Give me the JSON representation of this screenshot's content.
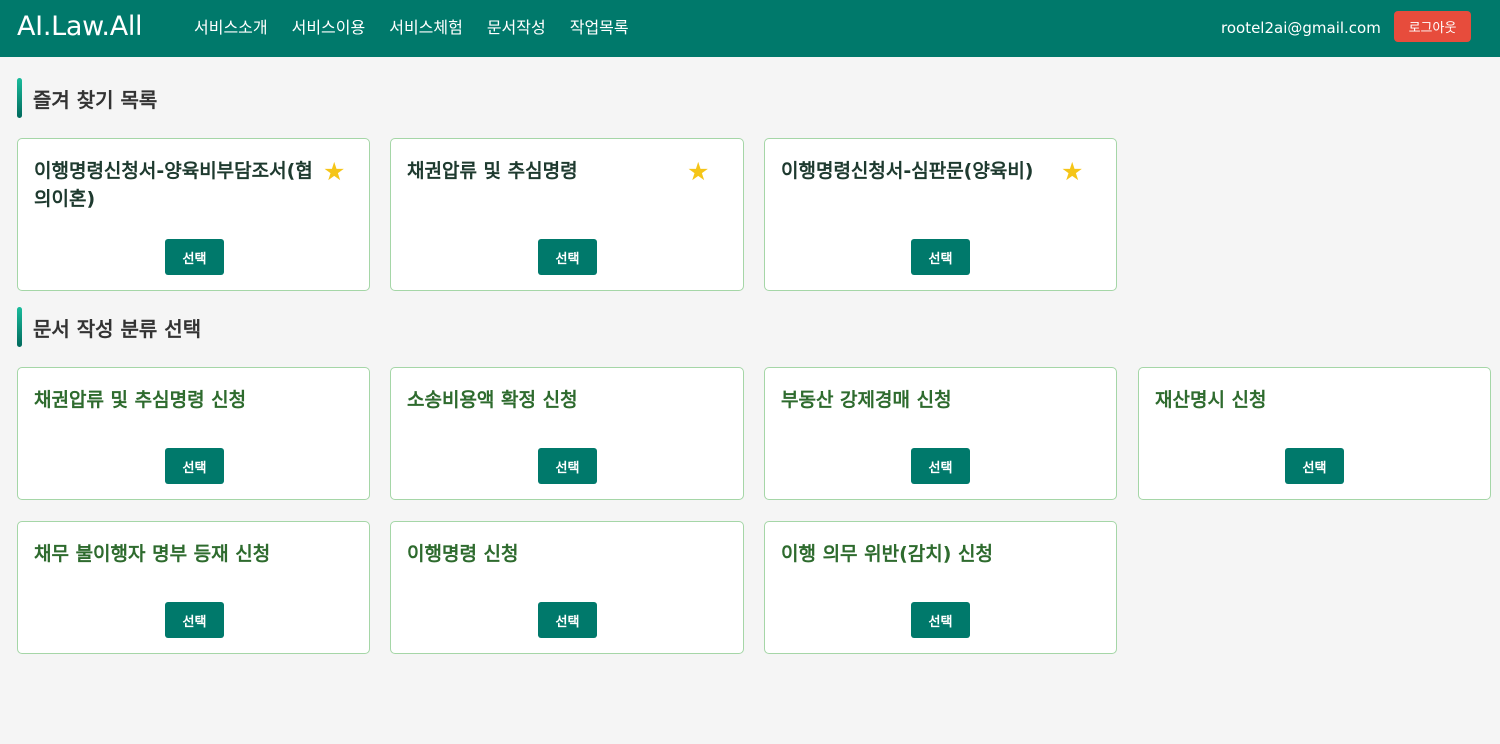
{
  "header": {
    "brand": "AI.Law.All",
    "nav": [
      "서비스소개",
      "서비스이용",
      "서비스체험",
      "문서작성",
      "작업목록"
    ],
    "user_email": "rootel2ai@gmail.com",
    "logout_label": "로그아웃"
  },
  "favorites": {
    "title": "즐겨 찾기 목록",
    "items": [
      {
        "title": "이행명령신청서-양육비부담조서(협의이혼)",
        "button": "선택",
        "starred": true
      },
      {
        "title": "채권압류 및 추심명령",
        "button": "선택",
        "starred": true
      },
      {
        "title": "이행명령신청서-심판문(양육비)",
        "button": "선택",
        "starred": true
      }
    ]
  },
  "categories": {
    "title": "문서 작성 분류 선택",
    "items": [
      {
        "title": "채권압류 및 추심명령 신청",
        "button": "선택"
      },
      {
        "title": "소송비용액 확정 신청",
        "button": "선택"
      },
      {
        "title": "부동산 강제경매 신청",
        "button": "선택"
      },
      {
        "title": "재산명시 신청",
        "button": "선택"
      },
      {
        "title": "채무 불이행자 명부 등재 신청",
        "button": "선택"
      },
      {
        "title": "이행명령 신청",
        "button": "선택"
      },
      {
        "title": "이행 의무 위반(감치) 신청",
        "button": "선택"
      }
    ]
  },
  "icons": {
    "star": "star-icon"
  },
  "colors": {
    "primary": "#00796b",
    "danger": "#e74c3c",
    "star": "#f5c518",
    "card_border": "#a5d6a7"
  }
}
